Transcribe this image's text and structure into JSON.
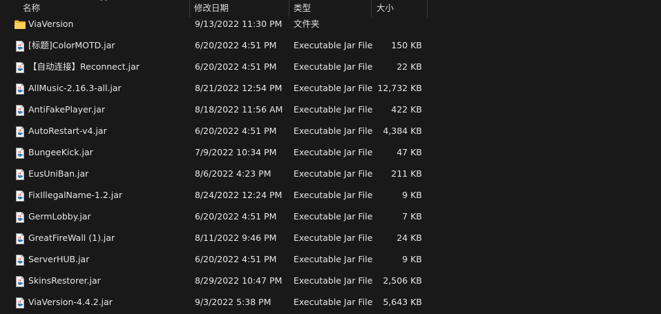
{
  "columns": {
    "name": "名称",
    "modified": "修改日期",
    "type": "类型",
    "size": "大小"
  },
  "sort_indicator": "chevron-up-icon",
  "colors": {
    "background": "#191919",
    "text": "#e6e6e6",
    "folder": "#f2c14e",
    "separator": "#3a3a3a"
  },
  "files": [
    {
      "name": "ViaVersion",
      "modified": "9/13/2022 11:30 PM",
      "type": "文件夹",
      "size": "",
      "icon": "folder-icon"
    },
    {
      "name": "[标题]ColorMOTD.jar",
      "modified": "6/20/2022 4:51 PM",
      "type": "Executable Jar File",
      "size": "150 KB",
      "icon": "jar-file-icon"
    },
    {
      "name": "【自动连接】Reconnect.jar",
      "modified": "6/20/2022 4:51 PM",
      "type": "Executable Jar File",
      "size": "22 KB",
      "icon": "jar-file-icon"
    },
    {
      "name": "AllMusic-2.16.3-all.jar",
      "modified": "8/21/2022 12:54 PM",
      "type": "Executable Jar File",
      "size": "12,732 KB",
      "icon": "jar-file-icon"
    },
    {
      "name": "AntiFakePlayer.jar",
      "modified": "8/18/2022 11:56 AM",
      "type": "Executable Jar File",
      "size": "422 KB",
      "icon": "jar-file-icon"
    },
    {
      "name": "AutoRestart-v4.jar",
      "modified": "6/20/2022 4:51 PM",
      "type": "Executable Jar File",
      "size": "4,384 KB",
      "icon": "jar-file-icon"
    },
    {
      "name": "BungeeKick.jar",
      "modified": "7/9/2022 10:34 PM",
      "type": "Executable Jar File",
      "size": "47 KB",
      "icon": "jar-file-icon"
    },
    {
      "name": "EusUniBan.jar",
      "modified": "8/6/2022 4:23 PM",
      "type": "Executable Jar File",
      "size": "211 KB",
      "icon": "jar-file-icon"
    },
    {
      "name": "FixIllegalName-1.2.jar",
      "modified": "8/24/2022 12:24 PM",
      "type": "Executable Jar File",
      "size": "9 KB",
      "icon": "jar-file-icon"
    },
    {
      "name": "GermLobby.jar",
      "modified": "6/20/2022 4:51 PM",
      "type": "Executable Jar File",
      "size": "7 KB",
      "icon": "jar-file-icon"
    },
    {
      "name": "GreatFireWall (1).jar",
      "modified": "8/11/2022 9:46 PM",
      "type": "Executable Jar File",
      "size": "24 KB",
      "icon": "jar-file-icon"
    },
    {
      "name": "ServerHUB.jar",
      "modified": "6/20/2022 4:51 PM",
      "type": "Executable Jar File",
      "size": "9 KB",
      "icon": "jar-file-icon"
    },
    {
      "name": "SkinsRestorer.jar",
      "modified": "8/29/2022 10:47 PM",
      "type": "Executable Jar File",
      "size": "2,506 KB",
      "icon": "jar-file-icon"
    },
    {
      "name": "ViaVersion-4.4.2.jar",
      "modified": "9/3/2022 5:38 PM",
      "type": "Executable Jar File",
      "size": "5,643 KB",
      "icon": "jar-file-icon"
    }
  ]
}
